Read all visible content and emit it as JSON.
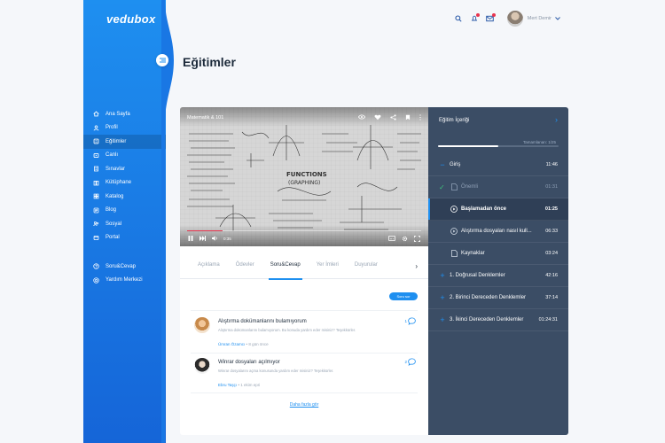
{
  "app": {
    "logo": "vedubox"
  },
  "sidebar": {
    "items": [
      {
        "label": "Ana Sayfa",
        "icon": "home-icon",
        "active": false
      },
      {
        "label": "Profil",
        "icon": "user-icon",
        "active": false
      },
      {
        "label": "Eğitimler",
        "icon": "book-icon",
        "active": true
      },
      {
        "label": "Canlı",
        "icon": "video-icon",
        "active": false
      },
      {
        "label": "Sınavlar",
        "icon": "exam-icon",
        "active": false
      },
      {
        "label": "Kütüphane",
        "icon": "library-icon",
        "active": false
      },
      {
        "label": "Katalog",
        "icon": "catalog-icon",
        "active": false
      },
      {
        "label": "Blog",
        "icon": "blog-icon",
        "active": false
      },
      {
        "label": "Sosyal",
        "icon": "social-icon",
        "active": false
      },
      {
        "label": "Portal",
        "icon": "portal-icon",
        "active": false
      }
    ],
    "bottom_items": [
      {
        "label": "Soru&Cevap",
        "icon": "question-icon"
      },
      {
        "label": "Yardım Merkezi",
        "icon": "help-icon"
      }
    ]
  },
  "header": {
    "title": "Eğitimler",
    "user_name": "Mert Demir"
  },
  "video": {
    "title": "Matematik & 101",
    "progress": 0.15,
    "time": "0:35"
  },
  "tabs": [
    {
      "label": "Açıklama",
      "active": false
    },
    {
      "label": "Ödevler",
      "active": false
    },
    {
      "label": "Soru&Cevap",
      "active": true
    },
    {
      "label": "Yer İmleri",
      "active": false
    },
    {
      "label": "Duyurular",
      "active": false
    }
  ],
  "qa": {
    "ask_label": "Soru sor",
    "questions": [
      {
        "title": "Alıştırma dokümanlarını bulamıyorum",
        "body": "Alıştırma dokümanlarını bulamıyorum. Bu konuda yardım eder misiniz? Teşekkürler.",
        "author": "Ümran Özamcı",
        "time": "8 gün önce",
        "count": "1"
      },
      {
        "title": "Winrar dosyaları açılmıyor",
        "body": "Winrar dosyalarını açma konusunda yardım eder misiniz? Teşekkürler.",
        "author": "Ebru Taşçı",
        "time": "1 ekim epri",
        "count": "2"
      }
    ],
    "more_label": "Daha fazla gör"
  },
  "content_panel": {
    "title": "Eğitim İçeriği",
    "progress_label": "Tamamlanan: 1/25",
    "progress": 0.5,
    "sections": [
      {
        "label": "Giriş",
        "duration": "11:46",
        "expanded": true
      },
      {
        "label": "Önemli",
        "duration": "01:31",
        "kind": "doc",
        "state": "done"
      },
      {
        "label": "Başlamadan önce",
        "duration": "01:25",
        "kind": "play",
        "state": "selected"
      },
      {
        "label": "Alıştırma dosyaları nasıl kull...",
        "duration": "06:33",
        "kind": "play",
        "state": "normal"
      },
      {
        "label": "Kaynaklar",
        "duration": "03:24",
        "kind": "doc",
        "state": "normal"
      },
      {
        "label": "1. Doğrusal Denklemler",
        "duration": "42:16",
        "expanded": false
      },
      {
        "label": "2. Birinci Dereceden Denklemler",
        "duration": "37:14",
        "expanded": false
      },
      {
        "label": "3. İkinci Dereceden Denklemler",
        "duration": "01:24:31",
        "expanded": false
      }
    ]
  },
  "colors": {
    "accent": "#1e8ff0",
    "panel": "#3b4d65",
    "sidebar": "#1565d8",
    "alert": "#e8344e"
  }
}
